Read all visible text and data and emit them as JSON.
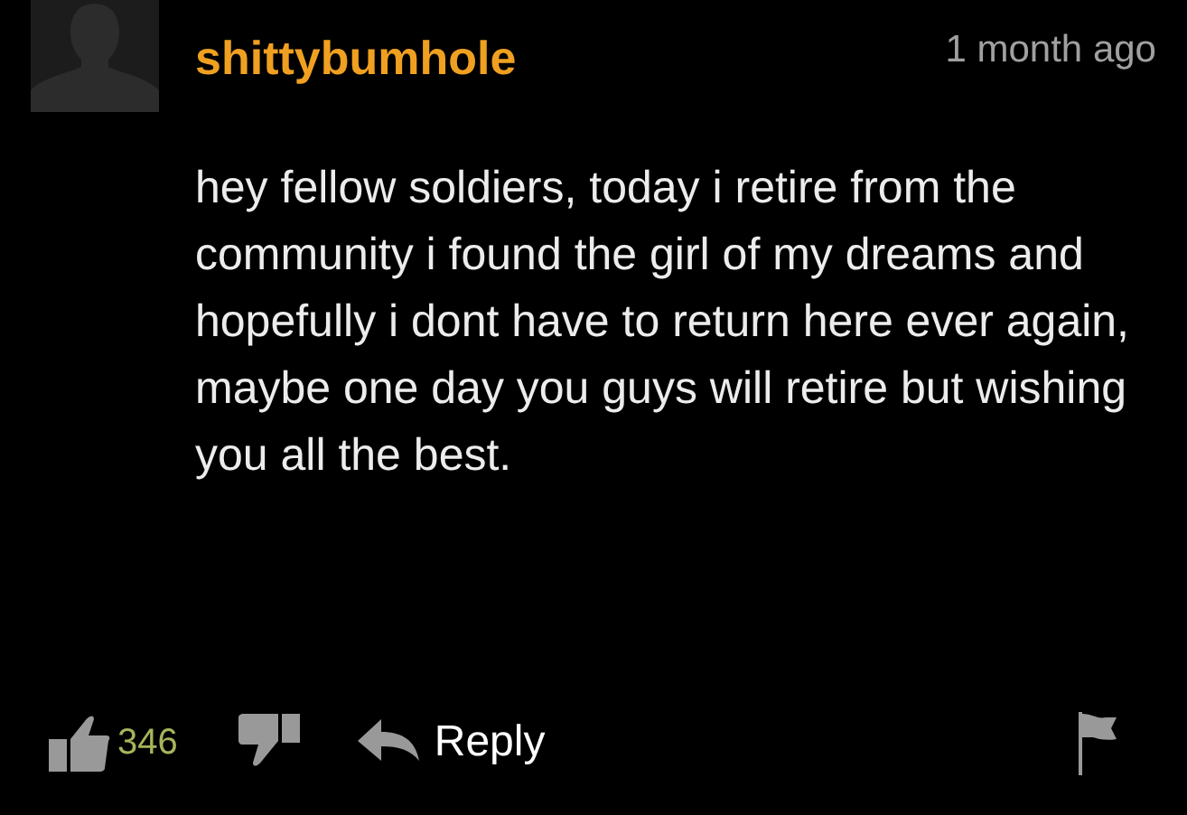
{
  "comment": {
    "username": "shittybumhole",
    "time": "1 month ago",
    "body": "hey fellow soldiers, today i retire from the community i found the girl of my dreams and hopefully i dont have to return here ever again, maybe one day you guys will retire but wishing you all the best.",
    "likes": "346",
    "reply_label": "Reply"
  }
}
